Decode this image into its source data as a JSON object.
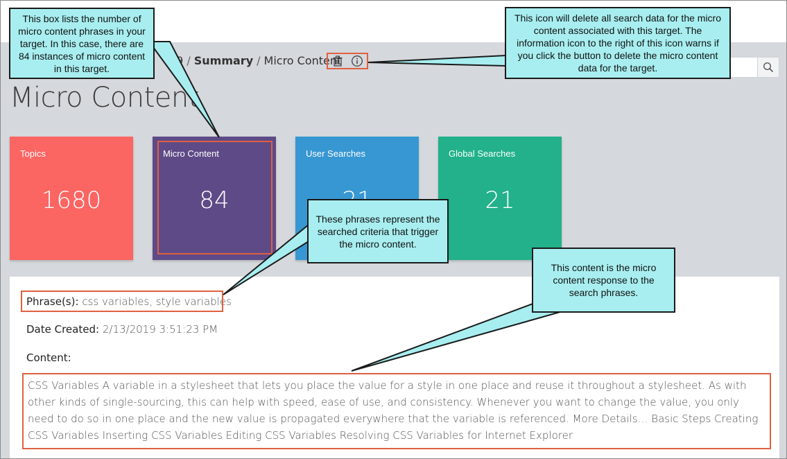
{
  "breadcrumb": {
    "partial": "19",
    "separator": "/",
    "summary": "Summary",
    "current": "Micro Content"
  },
  "page_title": "Micro Content",
  "tiles": [
    {
      "label": "Topics",
      "value": "1680",
      "color": "#fb6562"
    },
    {
      "label": "Micro Content",
      "value": "84",
      "color": "#5e4a87"
    },
    {
      "label": "User Searches",
      "value": "21",
      "color": "#3797d2"
    },
    {
      "label": "Global Searches",
      "value": "21",
      "color": "#22b18a"
    }
  ],
  "details": {
    "phrase_label": "Phrase(s):",
    "phrase_value": "css variables, style variables",
    "date_label": "Date Created:",
    "date_value": "2/13/2019 3:51:23 PM",
    "content_label": "Content:",
    "content_text": "CSS Variables A variable in a stylesheet that lets you place the value for a style in one place and reuse it throughout a stylesheet. As with other kinds of single-sourcing, this can help with speed, ease of use, and consistency. Whenever you want to change the value, you only need to do so in one place and the new value is propagated everywhere that the variable is referenced. More Details… Basic Steps Creating CSS Variables Inserting CSS Variables Editing CSS Variables Resolving CSS Variables for Internet Explorer"
  },
  "callouts": {
    "micro_box": "This box lists the number of micro content phrases in your target.  In this case, there are 84 instances of micro content in this target.",
    "delete_icon": "This icon will delete all search data for the micro content associated with this target. The information icon to the right of this icon warns if you click the button to delete the micro content data for the target.",
    "phrases": "These phrases represent the searched criteria that trigger the micro content.",
    "content": "This content is the micro content response to the search phrases."
  },
  "icons": {
    "delete": "trash-icon",
    "info": "info-icon",
    "search": "search-icon"
  },
  "colors": {
    "highlight": "#e06040",
    "callout_fill": "#a8eef0",
    "background": "#d5d8dc"
  }
}
